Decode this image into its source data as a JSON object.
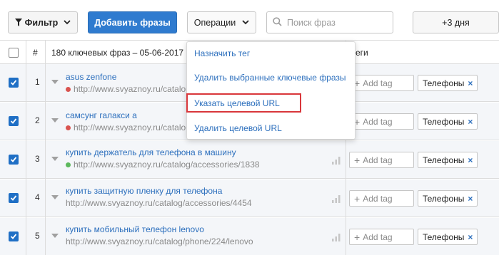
{
  "toolbar": {
    "filter_label": "Фильтр",
    "add_phrases_label": "Добавить фразы",
    "operations_label": "Операции",
    "search_placeholder": "Поиск фраз",
    "days_label": "+3 дня"
  },
  "table": {
    "header": {
      "num": "#",
      "phrases": "180 ключевых фраз – 05-06-2017",
      "tags": "еги"
    },
    "rows": [
      {
        "num": "1",
        "keyword": "asus zenfone",
        "url": "http://www.svyaznoy.ru/catalo",
        "dot": "#d9534f",
        "checked": true,
        "add_tag": "Add tag",
        "tag": "Телефоны"
      },
      {
        "num": "2",
        "keyword": "самсунг галакси а",
        "url": "http://www.svyaznoy.ru/catalo",
        "dot": "#d9534f",
        "checked": true,
        "add_tag": "Add tag",
        "tag": "Телефоны"
      },
      {
        "num": "3",
        "keyword": "купить держатель для телефона в машину",
        "url": "http://www.svyaznoy.ru/catalog/accessories/1838",
        "dot": "#5cb85c",
        "checked": true,
        "add_tag": "Add tag",
        "tag": "Телефоны"
      },
      {
        "num": "4",
        "keyword": "купить защитную пленку для телефона",
        "url": "http://www.svyaznoy.ru/catalog/accessories/4454",
        "dot": "",
        "checked": true,
        "add_tag": "Add tag",
        "tag": "Телефоны"
      },
      {
        "num": "5",
        "keyword": "купить мобильный телефон lenovo",
        "url": "http://www.svyaznoy.ru/catalog/phone/224/lenovo",
        "dot": "",
        "checked": true,
        "add_tag": "Add tag",
        "tag": "Телефоны"
      }
    ]
  },
  "operations_menu": {
    "items": [
      "Назначить тег",
      "Удалить выбранные ключевые фразы",
      "Указать целевой URL",
      "Удалить целевой URL"
    ],
    "highlighted_index": 2,
    "highlight_color": "#d9373b"
  },
  "colors": {
    "primary": "#2f7bcf",
    "link": "#2c6fbd",
    "checkbox": "#1f6fc5"
  }
}
